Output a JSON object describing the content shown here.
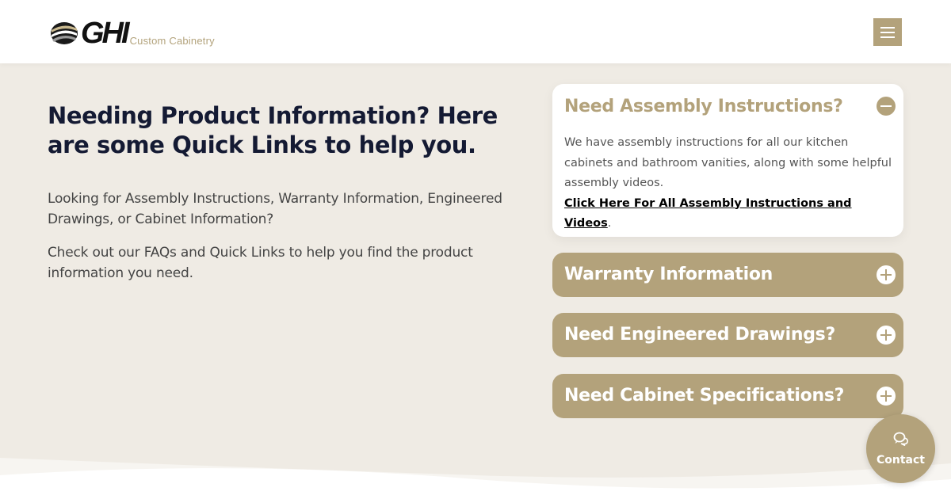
{
  "header": {
    "logo_text": "GHI",
    "logo_tagline": "Custom Cabinetry",
    "menu_icon": "hamburger-icon"
  },
  "intro": {
    "heading": "Needing Product Information? Here are some Quick Links to help you.",
    "paragraph1": "Looking for Assembly Instructions, Warranty Information, Engineered Drawings, or Cabinet Information?",
    "paragraph2": "Check out our FAQs and Quick Links to help you find the product information you need."
  },
  "accordion": {
    "items": [
      {
        "title": "Need Assembly Instructions?",
        "expanded": true,
        "icon": "minus-circle-icon",
        "body": "We have assembly instructions for all our kitchen cabinets and bathroom vanities, along with some helpful assembly videos.",
        "link_text": "Click Here For All Assembly Instructions and Videos",
        "link_suffix": "."
      },
      {
        "title": "Warranty Information",
        "expanded": false,
        "icon": "plus-circle-icon"
      },
      {
        "title": "Need Engineered Drawings?",
        "expanded": false,
        "icon": "plus-circle-icon"
      },
      {
        "title": "Need Cabinet Specifications?",
        "expanded": false,
        "icon": "plus-circle-icon"
      }
    ]
  },
  "contact": {
    "label": "Contact",
    "icon": "chat-bubbles-icon"
  },
  "colors": {
    "accent": "#b3a27b",
    "background": "#efebe4",
    "heading": "#141a33",
    "body_text": "#444444"
  }
}
